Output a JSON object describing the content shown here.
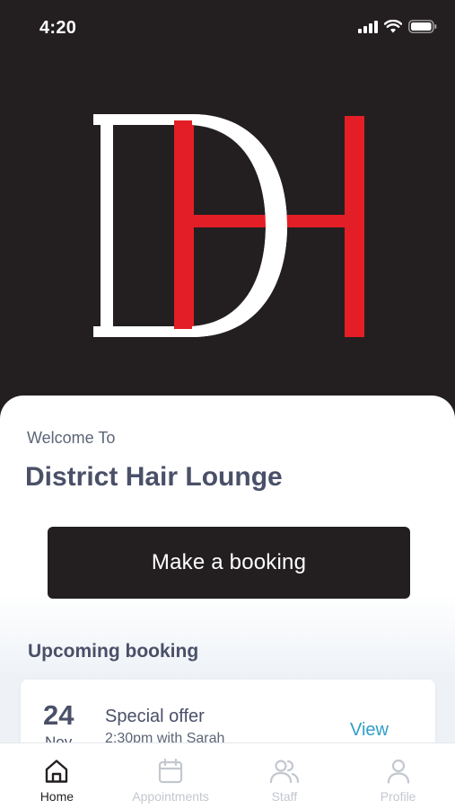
{
  "status_bar": {
    "time": "4:20"
  },
  "logo": {
    "text": "DH",
    "colors": {
      "letter": "#ffffff",
      "accent": "#e31e26",
      "background": "#231f20"
    }
  },
  "welcome": {
    "subtitle": "Welcome To",
    "business_name": "District Hair Lounge"
  },
  "cta": {
    "label": "Make a booking"
  },
  "upcoming": {
    "heading": "Upcoming booking",
    "booking": {
      "day": "24",
      "month": "Nov",
      "title": "Special offer",
      "detail": "2:30pm with Sarah",
      "action_label": "View"
    }
  },
  "nav": {
    "items": [
      {
        "label": "Home",
        "icon": "home-icon",
        "active": true
      },
      {
        "label": "Appointments",
        "icon": "calendar-icon",
        "active": false
      },
      {
        "label": "Staff",
        "icon": "users-icon",
        "active": false
      },
      {
        "label": "Profile",
        "icon": "user-icon",
        "active": false
      }
    ]
  },
  "theme": {
    "accent_link": "#2f9ec9",
    "heading": "#4a5068",
    "dark": "#231f20"
  }
}
